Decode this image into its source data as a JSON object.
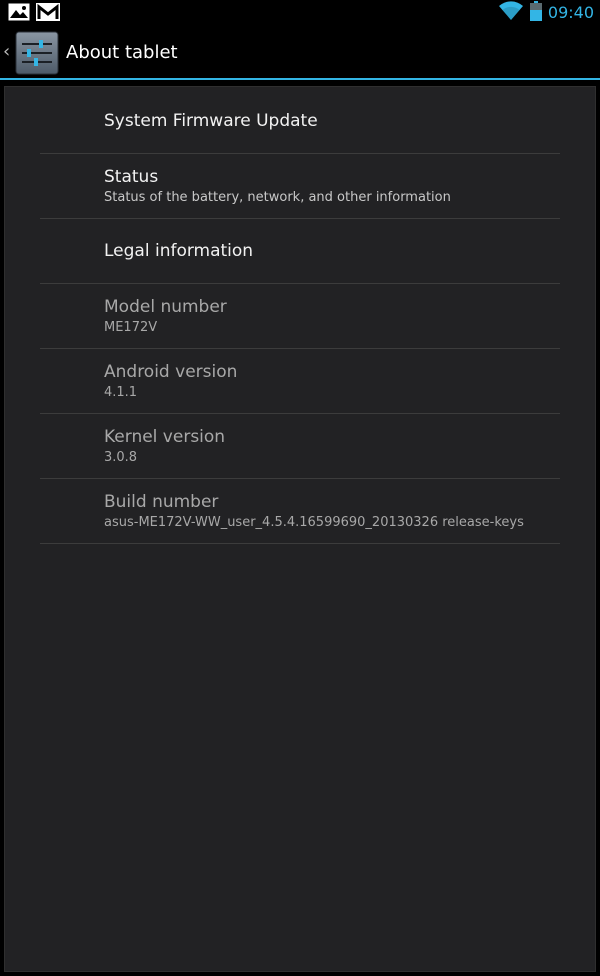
{
  "status_bar": {
    "time": "09:40",
    "left_icons": [
      "gallery-icon",
      "gmail-icon"
    ],
    "right_icons": [
      "wifi-icon",
      "battery-icon"
    ],
    "accent_color": "#33b5e5"
  },
  "action_bar": {
    "title": "About tablet",
    "icon": "settings-icon"
  },
  "items": [
    {
      "title": "System Firmware Update",
      "summary": ""
    },
    {
      "title": "Status",
      "summary": "Status of the battery, network, and other information"
    },
    {
      "title": "Legal information",
      "summary": ""
    },
    {
      "title": "Model number",
      "summary": "ME172V"
    },
    {
      "title": "Android version",
      "summary": "4.1.1"
    },
    {
      "title": "Kernel version",
      "summary": "3.0.8"
    },
    {
      "title": "Build number",
      "summary": "asus-ME172V-WW_user_4.5.4.16599690_20130326 release-keys"
    }
  ]
}
